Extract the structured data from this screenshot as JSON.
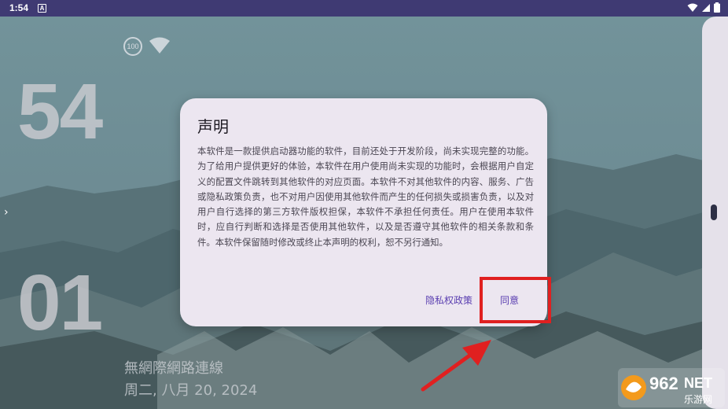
{
  "status_bar": {
    "time": "1:54",
    "notification_icon": "a-icon"
  },
  "widgets": {
    "battery_level": "100",
    "minutes": "54",
    "seconds": "01",
    "network_status": "無網際網路連線",
    "date": "周二, 八月 20, 2024"
  },
  "dialog": {
    "title": "声明",
    "body": "本软件是一款提供启动器功能的软件，目前还处于开发阶段，尚未实现完整的功能。为了给用户提供更好的体验，本软件在用户使用尚未实现的功能时，会根据用户自定义的配置文件跳转到其他软件的对应页面。本软件不对其他软件的内容、服务、广告或隐私政策负责，也不对用户因使用其他软件而产生的任何损失或损害负责，以及对用户自行选择的第三方软件版权担保，本软件不承担任何责任。用户在使用本软件时，应自行判断和选择是否使用其他软件，以及是否遵守其他软件的相关条款和条件。本软件保留随时修改或终止本声明的权利，恕不另行通知。",
    "privacy_button": "隐私权政策",
    "agree_button": "同意"
  },
  "watermark": {
    "brand": "962",
    "brand_suffix": "NET",
    "subtitle": "乐游网"
  },
  "colors": {
    "status_bar": "#3f3a73",
    "dialog_bg": "#ece6f0",
    "accent": "#5a3eb0",
    "highlight": "#e02020"
  }
}
